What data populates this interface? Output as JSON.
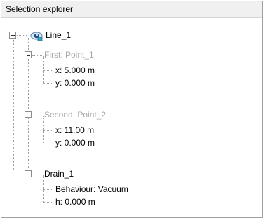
{
  "panel": {
    "title": "Selection explorer"
  },
  "tree": {
    "root": {
      "label": "Line_1",
      "icon": "eye-visible-icon"
    },
    "first": {
      "label": "First: Point_1",
      "x": "x: 5.000 m",
      "y": "y: 0.000 m"
    },
    "second": {
      "label": "Second: Point_2",
      "x": "x: 11.00 m",
      "y": "y: 0.000 m"
    },
    "drain": {
      "label": "Drain_1",
      "behaviour": "Behaviour: Vacuum",
      "h": "h: 0.000 m"
    }
  },
  "colors": {
    "muted_text": "#a8a8a8",
    "tree_lines": "#a0a0a0",
    "header_bg": "#f0f0f0"
  }
}
